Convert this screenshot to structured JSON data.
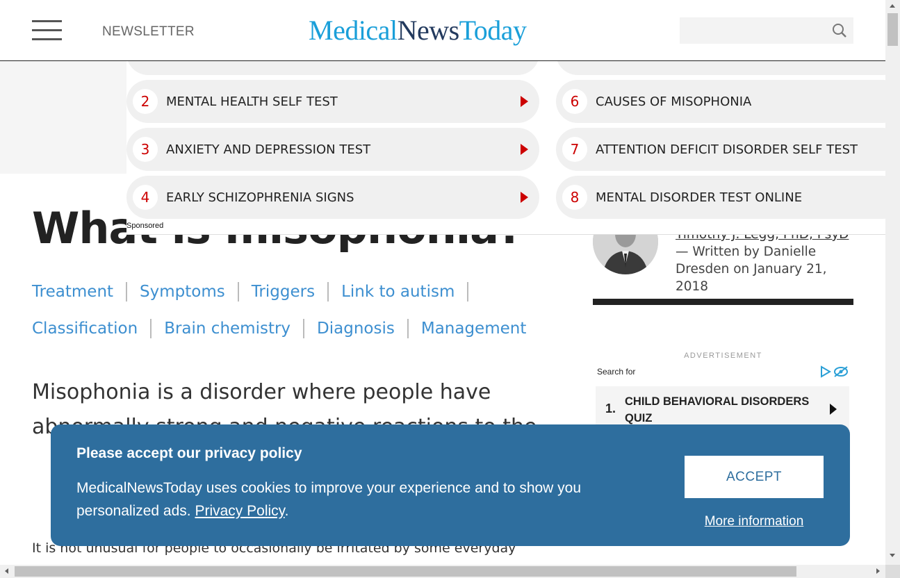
{
  "header": {
    "newsletter": "NEWSLETTER",
    "logo": {
      "medical": "Medical",
      "news": "News",
      "today": "Today"
    },
    "search_placeholder": ""
  },
  "sponsored_ad": {
    "label": "Sponsored",
    "items": [
      {
        "num": "2",
        "text": "MENTAL HEALTH SELF TEST"
      },
      {
        "num": "3",
        "text": "ANXIETY AND DEPRESSION TEST"
      },
      {
        "num": "4",
        "text": "EARLY SCHIZOPHRENIA SIGNS"
      },
      {
        "num": "6",
        "text": "CAUSES OF MISOPHONIA"
      },
      {
        "num": "7",
        "text": "ATTENTION DEFICIT DISORDER SELF TEST"
      },
      {
        "num": "8",
        "text": "MENTAL DISORDER TEST ONLINE"
      }
    ]
  },
  "article": {
    "title": "What is misophonia?",
    "toc": [
      "Treatment",
      "Symptoms",
      "Triggers",
      "Link to autism",
      "Classification",
      "Brain chemistry",
      "Diagnosis",
      "Management"
    ],
    "lead": "Misophonia is a disorder where people have abnormally strong and negative reactions to the",
    "paragraph": "It is not unusual for people to occasionally be irritated by some everyday"
  },
  "sidebar": {
    "reviewer": "Timothy J. Legg, PhD, PsyD",
    "written_prefix": "— Written by Danielle",
    "written_date": "Dresden on January 21, 2018",
    "advertisement_label": "ADVERTISEMENT",
    "search_for": "Search for",
    "ad_item": {
      "num": "1.",
      "text": "CHILD BEHAVIORAL DISORDERS QUIZ"
    }
  },
  "cookie_banner": {
    "title": "Please accept our privacy policy",
    "body": "MedicalNewsToday uses cookies to improve your experience and to show you personalized ads.",
    "link": "Privacy Policy",
    "accept": "ACCEPT",
    "more": "More information"
  },
  "colors": {
    "brand_light": "#1a9fd9",
    "brand_dark": "#233a5e",
    "link": "#3d8fd0",
    "ad_accent": "#cc0000",
    "cookie_bg": "#2e6e9e"
  }
}
